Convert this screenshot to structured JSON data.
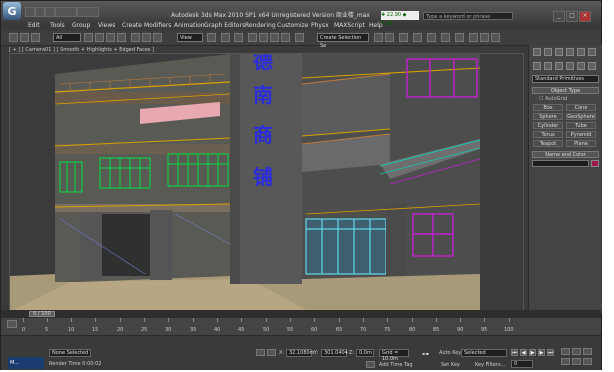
{
  "window": {
    "title": "Autodesk 3ds Max  2010 SP1 x64    Unregistered Version    商业楼_max",
    "search_placeholder": "Type a keyword or phrase",
    "controls": [
      "_",
      "□",
      "×"
    ]
  },
  "menu": [
    "Edit",
    "Tools",
    "Group",
    "Views",
    "Create",
    "Modifiers",
    "Animation",
    "Graph Editors",
    "Rendering",
    "Customize",
    "Physx",
    "MAXScript",
    "Help"
  ],
  "toolbar": {
    "selection_filter": "All",
    "reference_coord": "View",
    "named_selection": "Create Selection Se"
  },
  "viewport": {
    "label": "[ + ] [ Camera01 ] [ Smooth + Highlights + Edged Faces ]",
    "sign_chars": [
      "德",
      "南",
      "商",
      "铺"
    ]
  },
  "command_panel": {
    "category": "Standard Primitives",
    "object_type_header": "Object Type",
    "autogrid_label": "AutoGrid",
    "primitives": [
      "Box",
      "Cone",
      "Sphere",
      "GeoSphere",
      "Cylinder",
      "Tube",
      "Torus",
      "Pyramid",
      "Teapot",
      "Plane"
    ],
    "name_color_header": "Name and Color",
    "color": "#a0174a"
  },
  "timeline": {
    "slider_label": "0 / 100",
    "ticks": [
      "0",
      "5",
      "10",
      "15",
      "20",
      "25",
      "30",
      "35",
      "40",
      "45",
      "50",
      "55",
      "60",
      "65",
      "70",
      "75",
      "80",
      "85",
      "90",
      "95",
      "100"
    ]
  },
  "status": {
    "selection": "None Selected",
    "prompt": "Render Time  0:00:02",
    "x_label": "X:",
    "x_value": "32.1080m",
    "y_label": "Y:",
    "y_value": "301.0404",
    "z_label": "Z:",
    "z_value": "0.0m",
    "grid": "Grid = 10.0m",
    "add_time_tag": "Add Time Tag",
    "autokey": "Auto Key",
    "setkey": "Set Key",
    "key_filter": "Selected",
    "key_filters_btn": "Key Filters...",
    "taskbar": "M...",
    "frame": "0"
  },
  "colors": {
    "sign_blue": "#2a2ed8",
    "window_green": "#00e040",
    "window_purple": "#c020d0",
    "rail_cyan": "#18c8b0",
    "glass_blue": "#60d8e8"
  }
}
